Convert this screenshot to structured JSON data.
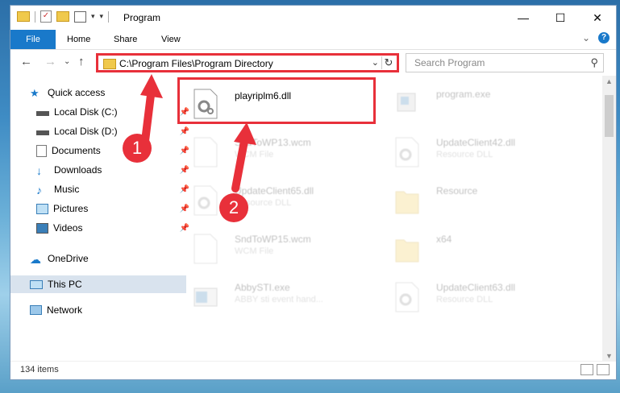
{
  "window": {
    "title": "Program",
    "controls": {
      "minimize": "—",
      "maximize": "☐",
      "close": "✕"
    }
  },
  "ribbon": {
    "tabs": [
      {
        "label": "File"
      },
      {
        "label": "Home"
      },
      {
        "label": "Share"
      },
      {
        "label": "View"
      }
    ]
  },
  "navigation": {
    "address": "C:\\Program Files\\Program Directory",
    "search_placeholder": "Search Program"
  },
  "sidebar": {
    "items": [
      {
        "label": "Quick access",
        "icon": "star-icon"
      },
      {
        "label": "Local Disk (C:)",
        "icon": "drive-icon"
      },
      {
        "label": "Local Disk (D:)",
        "icon": "drive-icon"
      },
      {
        "label": "Documents",
        "icon": "documents-icon"
      },
      {
        "label": "Downloads",
        "icon": "download-icon"
      },
      {
        "label": "Music",
        "icon": "music-icon"
      },
      {
        "label": "Pictures",
        "icon": "pictures-icon"
      },
      {
        "label": "Videos",
        "icon": "videos-icon"
      },
      {
        "label": "OneDrive",
        "icon": "cloud-icon"
      },
      {
        "label": "This PC",
        "icon": "computer-icon"
      },
      {
        "label": "Network",
        "icon": "network-icon"
      }
    ]
  },
  "files": [
    {
      "name": "playriplm6.dll",
      "type": ""
    },
    {
      "name": "program.exe",
      "type": ""
    },
    {
      "name": "SndToWP13.wcm",
      "type": "WCM File"
    },
    {
      "name": "UpdateClient42.dll",
      "type": "Resource DLL"
    },
    {
      "name": "UpdateClient65.dll",
      "type": "Resource DLL"
    },
    {
      "name": "Resource",
      "type": ""
    },
    {
      "name": "SndToWP15.wcm",
      "type": "WCM File"
    },
    {
      "name": "x64",
      "type": ""
    },
    {
      "name": "AbbySTI.exe",
      "type": "ABBY sti event hand..."
    },
    {
      "name": "UpdateClient63.dll",
      "type": "Resource DLL"
    }
  ],
  "status": {
    "item_count": "134 items"
  },
  "callouts": [
    "1",
    "2"
  ],
  "colors": {
    "accent": "#1979ca",
    "highlight": "#e8303a"
  }
}
